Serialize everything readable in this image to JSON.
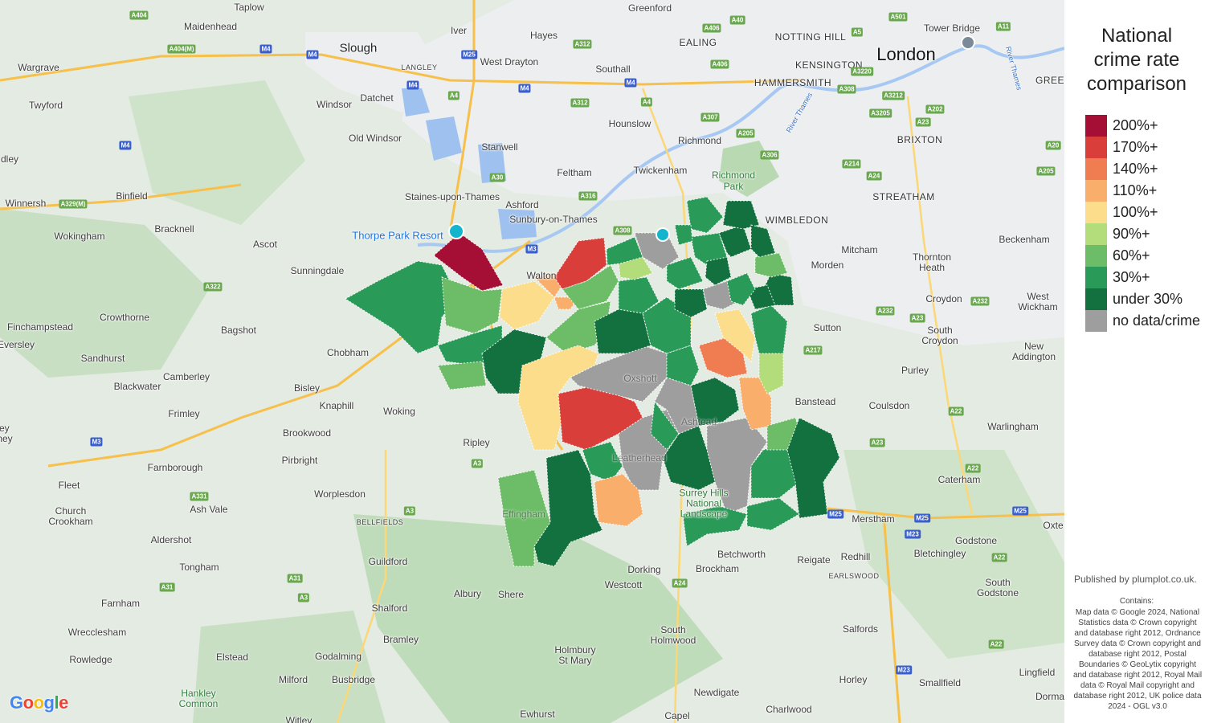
{
  "legend": {
    "title_line1": "National",
    "title_line2": "crime rate",
    "title_line3": "comparison",
    "items": [
      {
        "label": "200%+",
        "color": "#a50f35"
      },
      {
        "label": "170%+",
        "color": "#d93e3a"
      },
      {
        "label": "140%+",
        "color": "#f07c52"
      },
      {
        "label": "110%+",
        "color": "#f9ae6b"
      },
      {
        "label": "100%+",
        "color": "#fbdd8c"
      },
      {
        "label": "90%+",
        "color": "#b3dc7a"
      },
      {
        "label": "60%+",
        "color": "#6dbd68"
      },
      {
        "label": "30%+",
        "color": "#2a9a58"
      },
      {
        "label": "under 30%",
        "color": "#12713f"
      },
      {
        "label": "no data/crime",
        "color": "#9e9e9e"
      }
    ]
  },
  "credits": {
    "published": "Published by plumplot.co.uk.",
    "contains": "Contains:",
    "text": "Map data © Google 2024, National Statistics data © Crown copyright and database right 2012, Ordnance Survey data © Crown copyright and database right 2012, Postal Boundaries © GeoLytix copyright and database right 2012, Royal Mail data © Royal Mail copyright and database right 2012, UK police data 2024 - OGL v3.0"
  },
  "map": {
    "logo": "Google",
    "places": {
      "taplow": "Taplow",
      "maidenhead": "Maidenhead",
      "slough": "Slough",
      "iver": "Iver",
      "hayes": "Hayes",
      "greenford": "Greenford",
      "ealing": "EALING",
      "notting_hill": "NOTTING HILL",
      "kensington": "KENSINGTON",
      "london": "London",
      "tower_bridge": "Tower Bridge",
      "hammersmith": "HAMMERSMITH",
      "green": "GREE",
      "wargrave": "Wargrave",
      "twyford": "Twyford",
      "windsor": "Windsor",
      "datchet": "Datchet",
      "langley": "LANGLEY",
      "west_drayton": "West Drayton",
      "southall": "Southall",
      "hounslow": "Hounslow",
      "old_windsor": "Old Windsor",
      "stanwell": "Stanwell",
      "richmond": "Richmond",
      "brixton": "BRIXTON",
      "dley": "dley",
      "binfield": "Binfield",
      "feltham": "Feltham",
      "twickenham": "Twickenham",
      "richmond_park": "Richmond\nPark",
      "winnersh": "Winnersh",
      "staines": "Staines-upon-Thames",
      "ashford": "Ashford",
      "streatham": "STREATHAM",
      "wokingham": "Wokingham",
      "bracknell": "Bracknell",
      "thorpe_park": "Thorpe Park Resort",
      "sunbury": "Sunbury-on-Thames",
      "wimbledon": "WIMBLEDON",
      "beckenham": "Beckenham",
      "ascot": "Ascot",
      "sunningdale": "Sunningdale",
      "mitcham": "Mitcham",
      "morden": "Morden",
      "thornton_heath": "Thornton\nHeath",
      "walton": "Walton",
      "finchampstead": "Finchampstead",
      "crowthorne": "Crowthorne",
      "croydon": "Croydon",
      "west_wickham": "West\nWickham",
      "bagshot": "Bagshot",
      "sutton": "Sutton",
      "south_croydon": "South\nCroydon",
      "eversley": "Eversley",
      "sandhurst": "Sandhurst",
      "chobham": "Chobham",
      "new_addington": "New\nAddington",
      "camberley": "Camberley",
      "blackwater": "Blackwater",
      "bisley": "Bisley",
      "purley": "Purley",
      "oxshott": "Oxshott",
      "frimley": "Frimley",
      "knaphill": "Knaphill",
      "banstead": "Banstead",
      "coulsdon": "Coulsdon",
      "woking": "Woking",
      "brookwood": "Brookwood",
      "warlingham": "Warlingham",
      "ley_ney": "ley\nney",
      "ripley": "Ripley",
      "ashtead": "Ashtead",
      "pirbright": "Pirbright",
      "farnborough": "Farnborough",
      "leatherhead": "Leatherhead",
      "caterham": "Caterham",
      "fleet": "Fleet",
      "worplesdon": "Worplesdon",
      "church_crookham": "Church\nCrookham",
      "ash_vale": "Ash Vale",
      "effingham": "Effingham",
      "surrey_hills": "Surrey Hills\nNational\nLandscape",
      "merstham": "Merstham",
      "godstone": "Godstone",
      "oxted": "Oxte",
      "bellfields": "BELLFIELDS",
      "aldershot": "Aldershot",
      "guildford": "Guildford",
      "betchworth": "Betchworth",
      "reigate": "Reigate",
      "redhill": "Redhill",
      "bletchingley": "Bletchingley",
      "tongham": "Tongham",
      "dorking": "Dorking",
      "brockham": "Brockham",
      "earlswood": "EARLSWOOD",
      "south_godstone": "South\nGodstone",
      "farnham": "Farnham",
      "albury": "Albury",
      "shere": "Shere",
      "westcott": "Westcott",
      "shalford": "Shalford",
      "wrecclesham": "Wrecclesham",
      "south_holmwood": "South\nHolmwood",
      "salfords": "Salfords",
      "bramley": "Bramley",
      "rowledge": "Rowledge",
      "elstead": "Elstead",
      "godalming": "Godalming",
      "holmbury": "Holmbury\nSt Mary",
      "lingfield": "Lingfield",
      "horley": "Horley",
      "smallfield": "Smallfield",
      "hankley": "Hankley\nCommon",
      "milford": "Milford",
      "busbridge": "Busbridge",
      "newdigate": "Newdigate",
      "dorman": "Dorma",
      "ewhurst": "Ewhurst",
      "capel": "Capel",
      "charlwood": "Charlwood",
      "witley": "Witley",
      "river_thames": "River Thames",
      "river_thames_2": "River Thames"
    },
    "roads": {
      "a404": "A404",
      "a404m": "A404(M)",
      "m4_1": "M4",
      "m4_2": "M4",
      "m4_3": "M4",
      "m4_4": "M4",
      "m25_1": "M25",
      "a312": "A312",
      "a40_1": "A40",
      "a406_1": "A406",
      "a406_2": "A406",
      "a501": "A501",
      "a5": "A5",
      "a11": "A11",
      "a3220": "A3220",
      "a308_1": "A308",
      "a3212": "A3212",
      "a202": "A202",
      "a3205": "A3205",
      "a23_1": "A23",
      "a4_1": "A4",
      "a4_2": "A4",
      "a312_2": "A312",
      "a307": "A307",
      "a205": "A205",
      "a306": "A306",
      "a20": "A20",
      "a214": "A214",
      "a24_1": "A24",
      "a205_2": "A205",
      "a30": "A30",
      "a316": "A316",
      "a329m": "A329(M)",
      "m4_5": "M4",
      "a308_2": "A308",
      "m3_1": "M3",
      "a322": "A322",
      "a232_1": "A232",
      "a232_2": "A232",
      "a23_2": "A23",
      "a217": "A217",
      "m3_2": "M3",
      "a3_1": "A3",
      "a3_2": "A3",
      "a22_1": "A22",
      "a22_2": "A22",
      "a23_3": "A23",
      "a331": "A331",
      "a3_3": "A3",
      "m25_2": "M25",
      "m25_3": "M25",
      "m25_4": "M25",
      "m23_1": "M23",
      "a22_3": "A22",
      "a31_1": "A31",
      "a31_2": "A31",
      "a3_4": "A3",
      "a24_2": "A24",
      "a22_4": "A22",
      "m23_2": "M23"
    }
  }
}
